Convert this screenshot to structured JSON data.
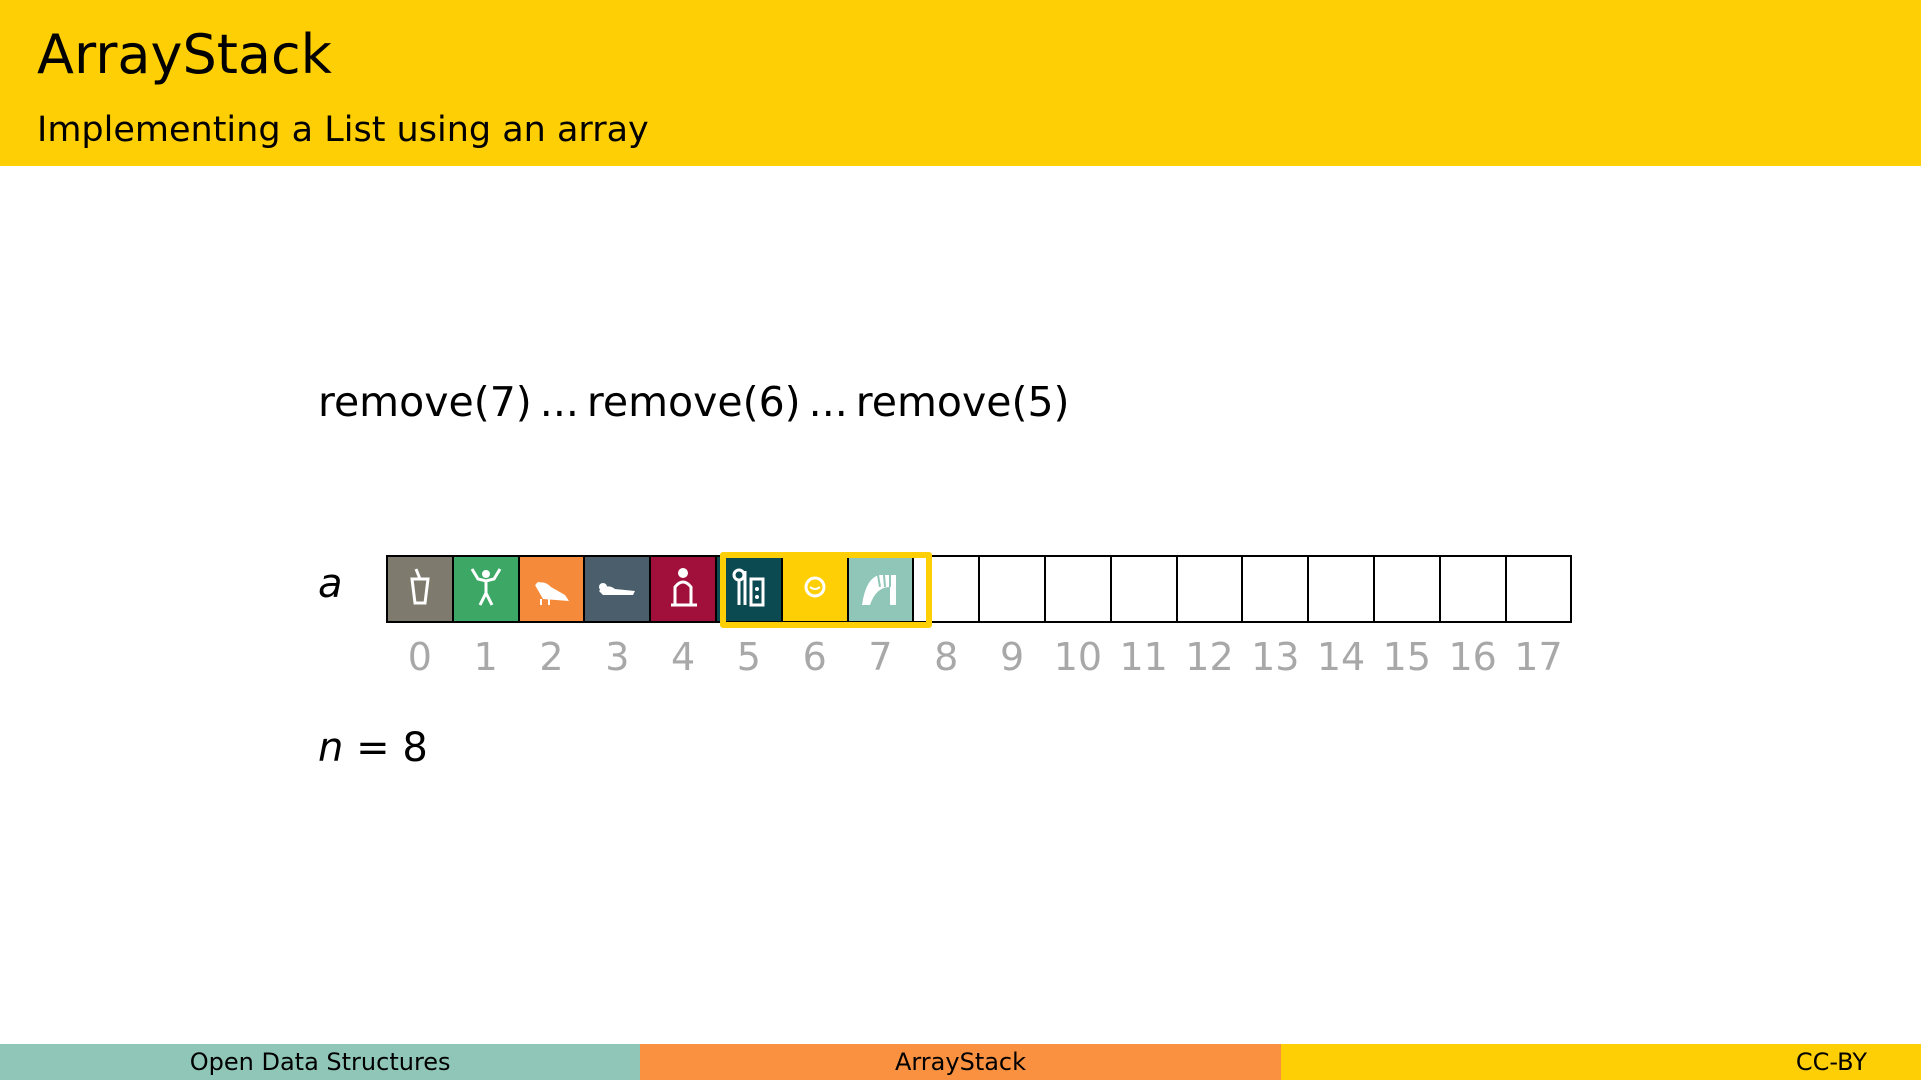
{
  "header": {
    "title": "ArrayStack",
    "subtitle": "Implementing a List using an array"
  },
  "operations": {
    "op1": "remove(7)",
    "op2": "remove(6)",
    "op3": "remove(5)",
    "separator": "..."
  },
  "array": {
    "label": "a",
    "length": 18,
    "cells": [
      {
        "index": "0",
        "color": "#7F7A6E",
        "icon": "bucket-glyph-icon"
      },
      {
        "index": "1",
        "color": "#3DA865",
        "icon": "person-arms-raised-glyph-icon"
      },
      {
        "index": "2",
        "color": "#F58A3B",
        "icon": "bird-glyph-icon"
      },
      {
        "index": "3",
        "color": "#4A5E6B",
        "icon": "reclining-animal-glyph-icon"
      },
      {
        "index": "4",
        "color": "#A0103A",
        "icon": "seated-figure-glyph-icon"
      },
      {
        "index": "5",
        "color": "#0C4A52",
        "icon": "vessels-glyph-icon"
      },
      {
        "index": "6",
        "color": "#FFCF06",
        "icon": "round-head-glyph-icon"
      },
      {
        "index": "7",
        "color": "#8FC6B8",
        "icon": "arch-glyph-icon"
      },
      {
        "index": "8",
        "color": "",
        "icon": ""
      },
      {
        "index": "9",
        "color": "",
        "icon": ""
      },
      {
        "index": "10",
        "color": "",
        "icon": ""
      },
      {
        "index": "11",
        "color": "",
        "icon": ""
      },
      {
        "index": "12",
        "color": "",
        "icon": ""
      },
      {
        "index": "13",
        "color": "",
        "icon": ""
      },
      {
        "index": "14",
        "color": "",
        "icon": ""
      },
      {
        "index": "15",
        "color": "",
        "icon": ""
      },
      {
        "index": "16",
        "color": "",
        "icon": ""
      },
      {
        "index": "17",
        "color": "",
        "icon": ""
      }
    ],
    "highlight_range": [
      5,
      7
    ],
    "highlight_color": "#FFCF06"
  },
  "n": {
    "variable": "n",
    "equals": "=",
    "value": "8"
  },
  "footer": {
    "left": "Open Data Structures",
    "middle": "ArrayStack",
    "right": "CC-BY"
  },
  "colors": {
    "accent_yellow": "#FFCF06",
    "accent_orange": "#F99141",
    "accent_teal": "#8FC6B8",
    "index_gray": "#A8A8A8"
  }
}
